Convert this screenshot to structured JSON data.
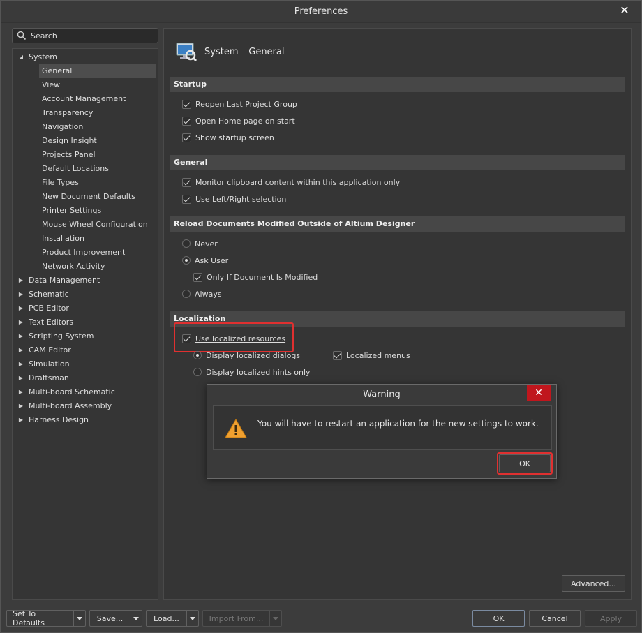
{
  "window": {
    "title": "Preferences"
  },
  "search": {
    "placeholder": "Search"
  },
  "tree": {
    "system": "System",
    "system_children": [
      "General",
      "View",
      "Account Management",
      "Transparency",
      "Navigation",
      "Design Insight",
      "Projects Panel",
      "Default Locations",
      "File Types",
      "New Document Defaults",
      "Printer Settings",
      "Mouse Wheel Configuration",
      "Installation",
      "Product Improvement",
      "Network Activity"
    ],
    "collapsed": [
      "Data Management",
      "Schematic",
      "PCB Editor",
      "Text Editors",
      "Scripting System",
      "CAM Editor",
      "Simulation",
      "Draftsman",
      "Multi-board Schematic",
      "Multi-board Assembly",
      "Harness Design"
    ]
  },
  "panel": {
    "title": "System – General",
    "startup": {
      "heading": "Startup",
      "reopen": "Reopen Last Project Group",
      "home": "Open Home page on start",
      "splash": "Show startup screen"
    },
    "general": {
      "heading": "General",
      "clipboard": "Monitor clipboard content within this application only",
      "leftright": "Use Left/Right selection"
    },
    "reload": {
      "heading": "Reload Documents Modified Outside of Altium Designer",
      "never": "Never",
      "ask": "Ask User",
      "only_modified": "Only If Document Is Modified",
      "always": "Always"
    },
    "localization": {
      "heading": "Localization",
      "use_localized": "Use localized resources",
      "dialogs": "Display localized dialogs",
      "menus": "Localized menus",
      "hints": "Display localized hints only"
    },
    "advanced": "Advanced..."
  },
  "footer": {
    "defaults": "Set To Defaults",
    "save": "Save...",
    "load": "Load...",
    "import": "Import From...",
    "ok": "OK",
    "cancel": "Cancel",
    "apply": "Apply"
  },
  "dialog": {
    "title": "Warning",
    "close": "✕",
    "message": "You will have to restart an application for the new settings to work.",
    "ok": "OK"
  },
  "colors": {
    "highlight": "#e03030",
    "close_red": "#c0161d",
    "warning": "#f0a030"
  }
}
